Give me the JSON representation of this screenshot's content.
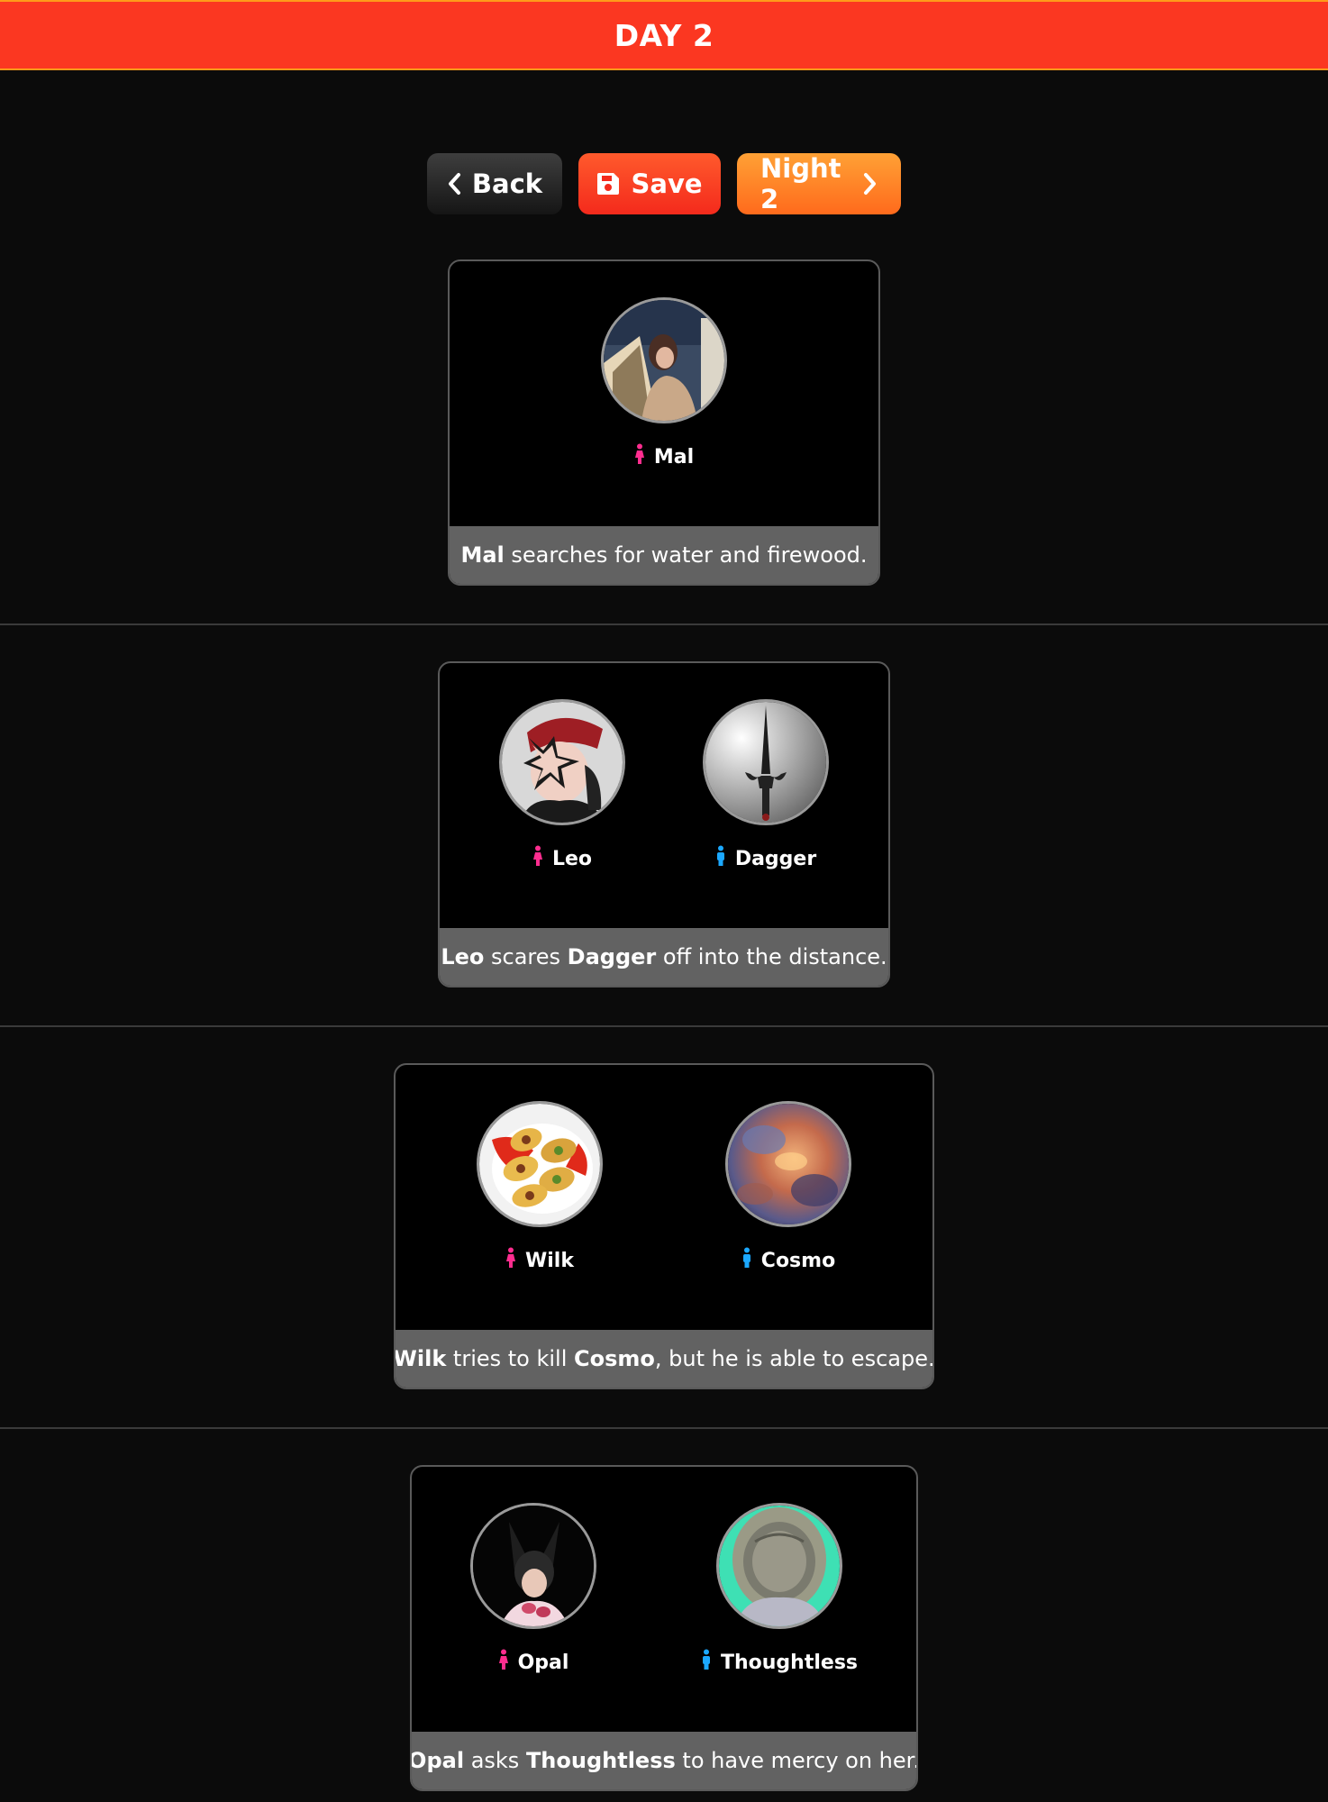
{
  "header": {
    "title": "DAY 2"
  },
  "toolbar": {
    "back_label": "Back",
    "save_label": "Save",
    "next_label": "Night 2"
  },
  "colors": {
    "header_bg": "#fb3721",
    "female_icon": "#ff2d8f",
    "male_icon": "#1ba8ff",
    "caption_bg": "#626262"
  },
  "events": [
    {
      "tributes": [
        {
          "name": "Mal",
          "gender": "female"
        }
      ],
      "caption": {
        "p1": "Mal",
        "t1": " searches for water and firewood."
      }
    },
    {
      "tributes": [
        {
          "name": "Leo",
          "gender": "female"
        },
        {
          "name": "Dagger",
          "gender": "male"
        }
      ],
      "caption": {
        "p1": "Leo",
        "t1": " scares ",
        "p2": "Dagger",
        "t2": " off into the distance."
      }
    },
    {
      "tributes": [
        {
          "name": "Wilk",
          "gender": "female"
        },
        {
          "name": "Cosmo",
          "gender": "male"
        }
      ],
      "caption": {
        "p1": "Wilk",
        "t1": " tries to kill ",
        "p2": "Cosmo",
        "t2": ", but he is able to escape."
      }
    },
    {
      "tributes": [
        {
          "name": "Opal",
          "gender": "female"
        },
        {
          "name": "Thoughtless",
          "gender": "male"
        }
      ],
      "caption": {
        "p1": "Opal",
        "t1": " asks ",
        "p2": "Thoughtless",
        "t2": " to have mercy on her."
      }
    }
  ]
}
